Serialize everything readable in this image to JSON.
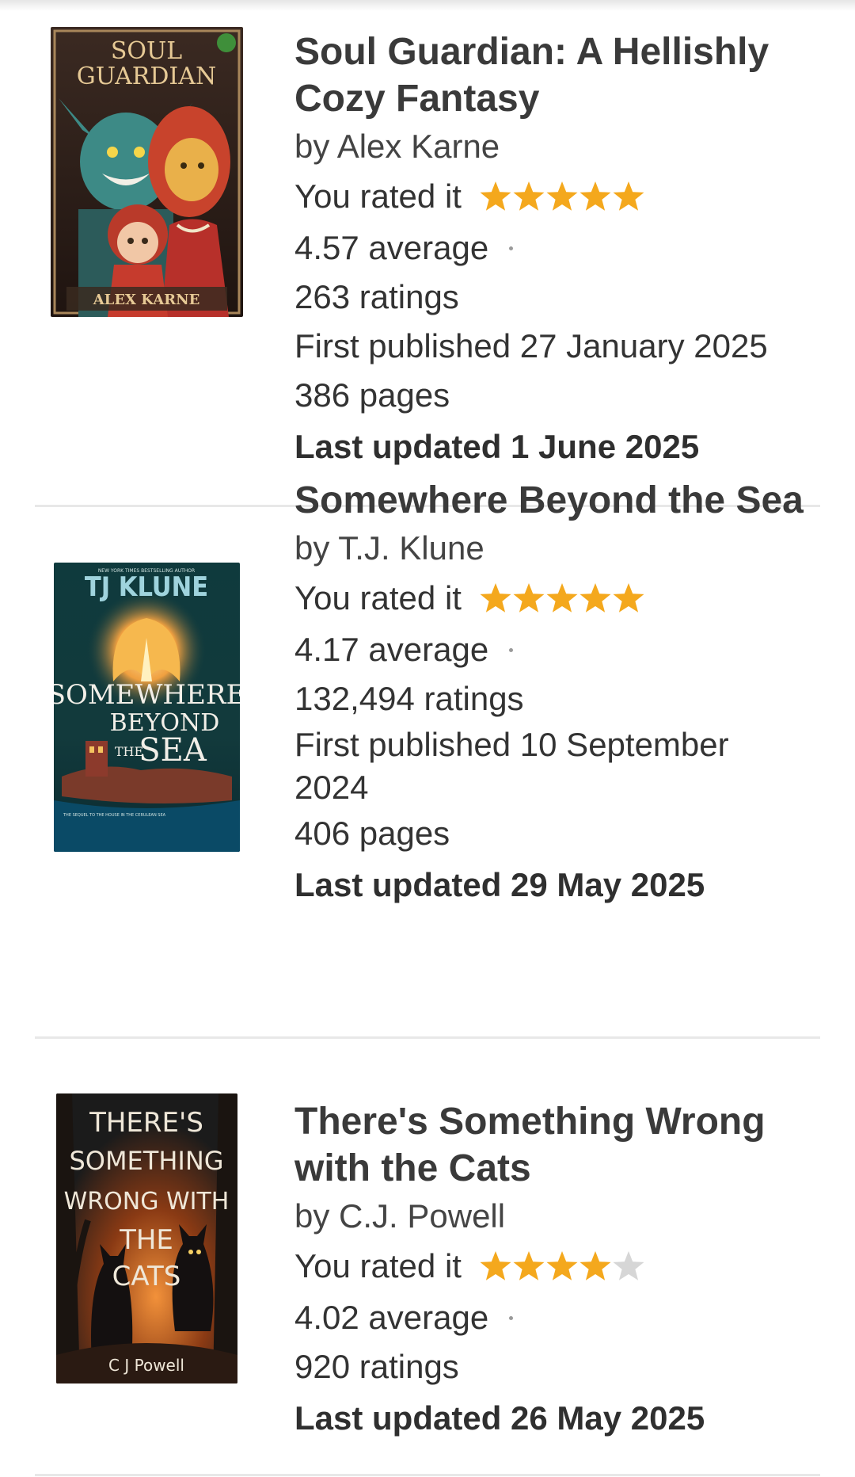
{
  "colors": {
    "star_filled": "#f4a81d",
    "star_empty": "#d6d6d6",
    "divider": "#e8e8e8"
  },
  "books": [
    {
      "title": "Soul Guardian: A Hellishly Cozy Fantasy",
      "author": "by Alex Karne",
      "rated_label": "You rated it",
      "user_rating": 5,
      "average": "4.57 average",
      "ratings": "263 ratings",
      "first_published": "First published 27 January 2025",
      "pages": "386 pages",
      "last_updated": "Last updated 1 June 2025",
      "cover": {
        "title_lines": [
          "SOUL",
          "GUARDIAN"
        ],
        "author": "ALEX KARNE"
      }
    },
    {
      "title": "Somewhere Beyond the Sea",
      "author": "by T.J. Klune",
      "rated_label": "You rated it",
      "user_rating": 5,
      "average": "4.17 average",
      "ratings": "132,494 ratings",
      "first_published": "First published 10 September 2024",
      "pages": "406 pages",
      "last_updated": "Last updated 29 May 2025",
      "cover": {
        "tagline": "NEW YORK TIMES BESTSELLING AUTHOR",
        "author": "TJ KLUNE",
        "title_lines": [
          "SOMEWHERE",
          "BEYOND",
          "THE",
          "SEA"
        ],
        "subtitle": "THE SEQUEL TO THE HOUSE IN THE CERULEAN SEA"
      }
    },
    {
      "title": "There's Something Wrong with the Cats",
      "author": "by C.J. Powell",
      "rated_label": "You rated it",
      "user_rating": 4,
      "average": "4.02 average",
      "ratings": "920 ratings",
      "last_updated": "Last updated 26 May 2025",
      "cover": {
        "title_lines": [
          "THERE'S",
          "SOMETHING",
          "WRONG WITH",
          "THE",
          "CATS"
        ],
        "author": "C J Powell"
      }
    }
  ]
}
